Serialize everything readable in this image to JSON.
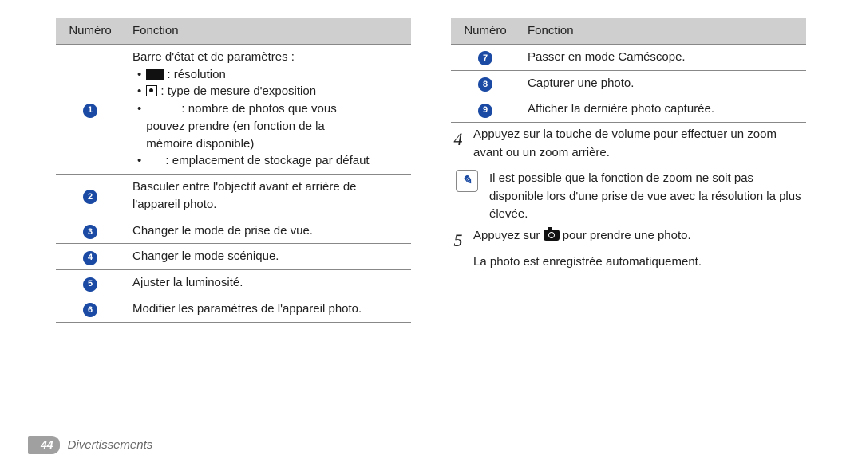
{
  "left_table": {
    "headers": {
      "num": "Numéro",
      "func": "Fonction"
    },
    "row1": {
      "title": "Barre d'état et de paramètres :",
      "b1_after": " : résolution",
      "b2_after": " : type de mesure d'exposition",
      "b3a": " : nombre de photos que vous",
      "b3b": "pouvez prendre (en fonction de la",
      "b3c": "mémoire disponible)",
      "b4": " : emplacement de stockage par défaut"
    },
    "row2": "Basculer entre l'objectif avant et arrière de l'appareil photo.",
    "row3": "Changer le mode de prise de vue.",
    "row4": "Changer le mode scénique.",
    "row5": "Ajuster la luminosité.",
    "row6": "Modifier les paramètres de l'appareil photo."
  },
  "right_table": {
    "headers": {
      "num": "Numéro",
      "func": "Fonction"
    },
    "row7": "Passer en mode Caméscope.",
    "row8": "Capturer une photo.",
    "row9": "Afficher la dernière photo capturée."
  },
  "steps": {
    "s4num": "4",
    "s4": "Appuyez sur la touche de volume pour effectuer un zoom avant ou un zoom arrière.",
    "note": "Il est possible que la fonction de zoom ne soit pas disponible lors d'une prise de vue avec la résolution la plus élevée.",
    "s5num": "5",
    "s5_before": "Appuyez sur ",
    "s5_after": " pour prendre une photo.",
    "s5_line2": "La photo est enregistrée automatiquement."
  },
  "nums": {
    "n1": "1",
    "n2": "2",
    "n3": "3",
    "n4": "4",
    "n5": "5",
    "n6": "6",
    "n7": "7",
    "n8": "8",
    "n9": "9"
  },
  "footer": {
    "page": "44",
    "section": "Divertissements"
  }
}
